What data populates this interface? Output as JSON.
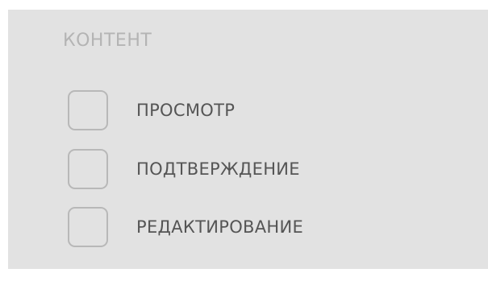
{
  "section": {
    "title": "КОНТЕНТ",
    "options": [
      {
        "label": "ПРОСМОТР",
        "checked": false
      },
      {
        "label": "ПОДТВЕРЖДЕНИЕ",
        "checked": false
      },
      {
        "label": "РЕДАКТИРОВАНИЕ",
        "checked": false
      }
    ]
  }
}
